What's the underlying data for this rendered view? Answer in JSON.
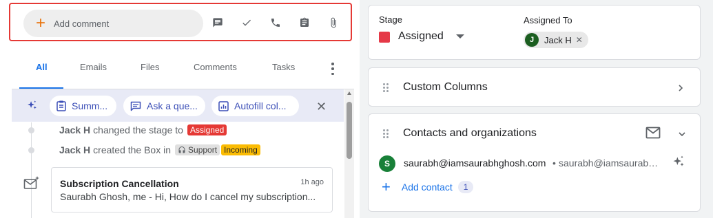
{
  "composer": {
    "add_comment_label": "Add comment",
    "icons": [
      "comment-icon",
      "check-icon",
      "phone-icon",
      "clipboard-icon",
      "attachment-icon"
    ]
  },
  "tabs": [
    {
      "label": "All",
      "active": true
    },
    {
      "label": "Emails"
    },
    {
      "label": "Files"
    },
    {
      "label": "Comments"
    },
    {
      "label": "Tasks"
    }
  ],
  "ai_bar": {
    "chips": [
      {
        "label": "Summ...",
        "icon": "summary-icon"
      },
      {
        "label": "Ask a que...",
        "icon": "chat-icon"
      },
      {
        "label": "Autofill col...",
        "icon": "autofill-icon"
      }
    ]
  },
  "timeline": {
    "events": [
      {
        "actor": "Jack H",
        "text": "changed the stage to",
        "tag": "Assigned"
      },
      {
        "actor": "Jack H",
        "text": "created the Box in",
        "pipeline": "Support",
        "stage": "Incoming"
      }
    ],
    "email": {
      "subject": "Subscription Cancellation",
      "time": "1h ago",
      "snippet": "Saurabh Ghosh, me - Hi, How do I cancel my subscription..."
    }
  },
  "stage_card": {
    "stage_label": "Stage",
    "stage_value": "Assigned",
    "stage_color": "#e53947",
    "assigned_label": "Assigned To",
    "assignee_initial": "J",
    "assignee_name": "Jack H",
    "remove_symbol": "✕"
  },
  "custom_columns": {
    "title": "Custom Columns"
  },
  "contacts": {
    "title": "Contacts and organizations",
    "contact_initial": "S",
    "contact_email": "saurabh@iamsaurabhghosh.com",
    "separator": "•",
    "contact_sub": "saurabh@iamsaurabhghosh.com",
    "add_label": "Add contact",
    "count": "1"
  }
}
